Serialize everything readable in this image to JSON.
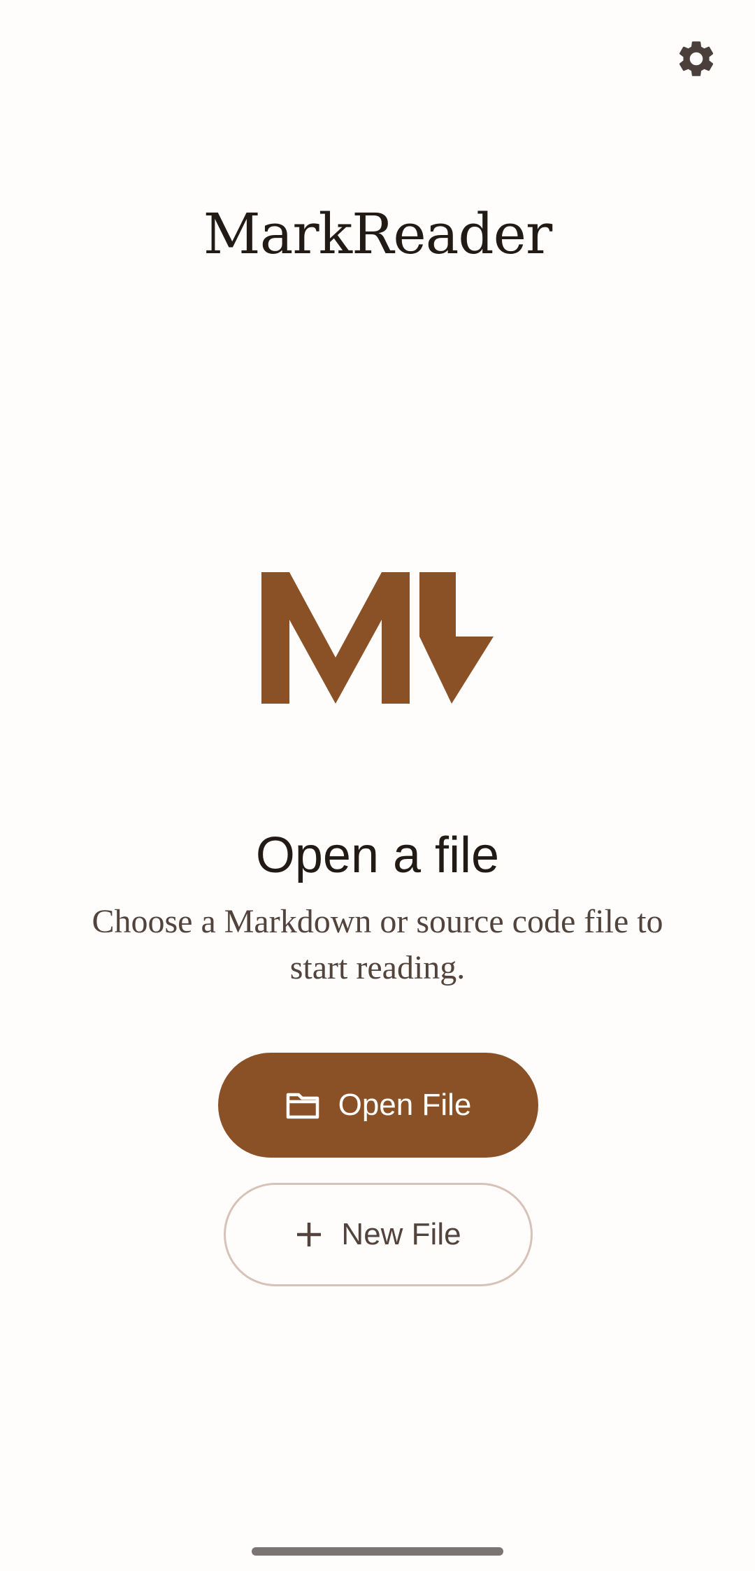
{
  "app": {
    "title": "MarkReader"
  },
  "toolbar": {
    "settings_icon": "gear-icon"
  },
  "logo": {
    "icon": "markdown-logo",
    "color": "#8b5126"
  },
  "empty_state": {
    "heading": "Open a file",
    "description": "Choose a Markdown or source code file to start reading."
  },
  "actions": {
    "open_file": {
      "label": "Open File",
      "icon": "folder-icon",
      "background": "#8b5126"
    },
    "new_file": {
      "label": "New File",
      "icon": "plus-icon",
      "border": "#d7c2b8"
    }
  },
  "colors": {
    "background": "#fffdfc",
    "primary": "#8b5126",
    "text": "#211a15",
    "secondary_text": "#52443c"
  }
}
